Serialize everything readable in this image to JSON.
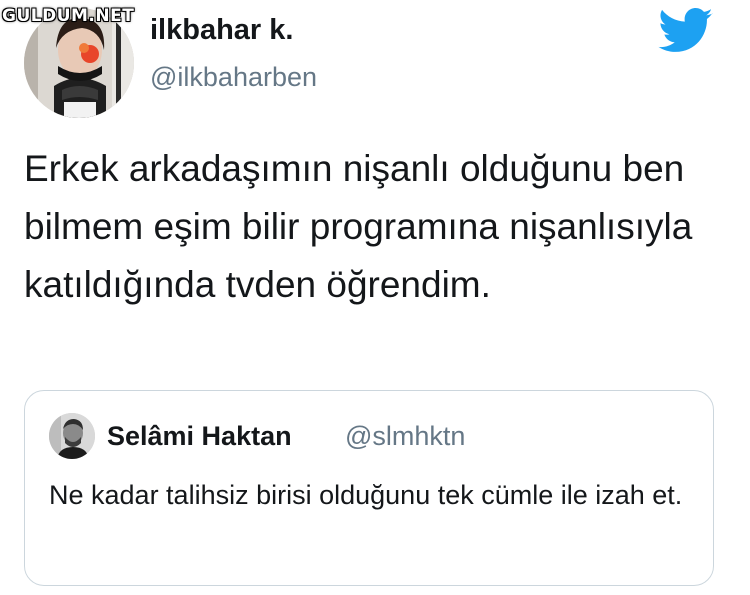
{
  "watermark": "GULDUM.NET",
  "author": {
    "display_name": "ilkbahar k.",
    "handle": "@ilkbaharben",
    "avatar_icon": "profile-photo"
  },
  "tweet": {
    "text": "Erkek arkadaşımın nişanlı olduğunu ben bilmem eşim bilir programına nişanlısıyla katıldığında tvden öğrendim."
  },
  "quoted_tweet": {
    "display_name": "Selâmi Haktan",
    "handle": "@slmhktn",
    "text": "Ne kadar talihsiz birisi olduğunu tek cümle ile izah et."
  },
  "colors": {
    "twitter_blue": "#1da1f2",
    "secondary_text": "#657786",
    "border": "#ccd6dd"
  },
  "icons": {
    "brand": "twitter-bird-icon"
  }
}
